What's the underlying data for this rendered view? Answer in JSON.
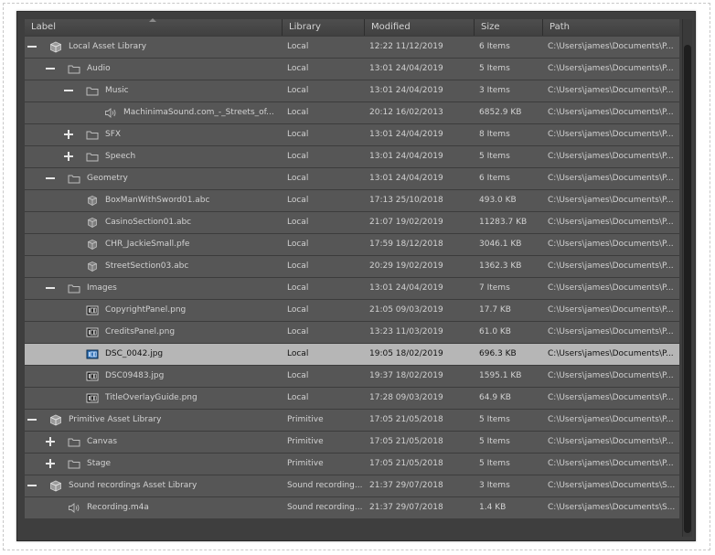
{
  "columns": {
    "label": "Label",
    "library": "Library",
    "modified": "Modified",
    "size": "Size",
    "path": "Path"
  },
  "rows": [
    {
      "depth": 0,
      "toggle": "minus",
      "icon": "asset-library-icon",
      "label": "Local Asset Library",
      "library": "Local",
      "modified": "12:22  11/12/2019",
      "size": "6 Items",
      "path": "C:\\Users\\james\\Documents\\P..."
    },
    {
      "depth": 1,
      "toggle": "minus",
      "icon": "folder-icon",
      "label": "Audio",
      "library": "Local",
      "modified": "13:01  24/04/2019",
      "size": "5 Items",
      "path": "C:\\Users\\james\\Documents\\P..."
    },
    {
      "depth": 2,
      "toggle": "minus",
      "icon": "folder-icon",
      "label": "Music",
      "library": "Local",
      "modified": "13:01  24/04/2019",
      "size": "3 Items",
      "path": "C:\\Users\\james\\Documents\\P..."
    },
    {
      "depth": 3,
      "toggle": "none",
      "icon": "sound-icon",
      "label": "MachinimaSound.com_-_Streets_of...",
      "library": "Local",
      "modified": "20:12  16/02/2013",
      "size": "6852.9 KB",
      "path": "C:\\Users\\james\\Documents\\P..."
    },
    {
      "depth": 2,
      "toggle": "plus",
      "icon": "folder-icon",
      "label": "SFX",
      "library": "Local",
      "modified": "13:01  24/04/2019",
      "size": "8 Items",
      "path": "C:\\Users\\james\\Documents\\P..."
    },
    {
      "depth": 2,
      "toggle": "plus",
      "icon": "folder-icon",
      "label": "Speech",
      "library": "Local",
      "modified": "13:01  24/04/2019",
      "size": "5 Items",
      "path": "C:\\Users\\james\\Documents\\P..."
    },
    {
      "depth": 1,
      "toggle": "minus",
      "icon": "folder-icon",
      "label": "Geometry",
      "library": "Local",
      "modified": "13:01  24/04/2019",
      "size": "6 Items",
      "path": "C:\\Users\\james\\Documents\\P..."
    },
    {
      "depth": 2,
      "toggle": "none",
      "icon": "geometry-icon",
      "label": "BoxManWithSword01.abc",
      "library": "Local",
      "modified": "17:13  25/10/2018",
      "size": "493.0 KB",
      "path": "C:\\Users\\james\\Documents\\P..."
    },
    {
      "depth": 2,
      "toggle": "none",
      "icon": "geometry-icon",
      "label": "CasinoSection01.abc",
      "library": "Local",
      "modified": "21:07  19/02/2019",
      "size": "11283.7 KB",
      "path": "C:\\Users\\james\\Documents\\P..."
    },
    {
      "depth": 2,
      "toggle": "none",
      "icon": "geometry-icon",
      "label": "CHR_JackieSmall.pfe",
      "library": "Local",
      "modified": "17:59  18/12/2018",
      "size": "3046.1 KB",
      "path": "C:\\Users\\james\\Documents\\P..."
    },
    {
      "depth": 2,
      "toggle": "none",
      "icon": "geometry-icon",
      "label": "StreetSection03.abc",
      "library": "Local",
      "modified": "20:29  19/02/2019",
      "size": "1362.3 KB",
      "path": "C:\\Users\\james\\Documents\\P..."
    },
    {
      "depth": 1,
      "toggle": "minus",
      "icon": "folder-icon",
      "label": "Images",
      "library": "Local",
      "modified": "13:01  24/04/2019",
      "size": "7 Items",
      "path": "C:\\Users\\james\\Documents\\P..."
    },
    {
      "depth": 2,
      "toggle": "none",
      "icon": "image-icon",
      "label": "CopyrightPanel.png",
      "library": "Local",
      "modified": "21:05  09/03/2019",
      "size": "17.7 KB",
      "path": "C:\\Users\\james\\Documents\\P..."
    },
    {
      "depth": 2,
      "toggle": "none",
      "icon": "image-icon",
      "label": "CreditsPanel.png",
      "library": "Local",
      "modified": "13:23  11/03/2019",
      "size": "61.0 KB",
      "path": "C:\\Users\\james\\Documents\\P..."
    },
    {
      "depth": 2,
      "toggle": "none",
      "icon": "image-icon",
      "label": "DSC_0042.jpg",
      "library": "Local",
      "modified": "19:05  18/02/2019",
      "size": "696.3 KB",
      "path": "C:\\Users\\james\\Documents\\P...",
      "selected": true
    },
    {
      "depth": 2,
      "toggle": "none",
      "icon": "image-icon",
      "label": "DSC09483.jpg",
      "library": "Local",
      "modified": "19:37  18/02/2019",
      "size": "1595.1 KB",
      "path": "C:\\Users\\james\\Documents\\P..."
    },
    {
      "depth": 2,
      "toggle": "none",
      "icon": "image-icon",
      "label": "TitleOverlayGuide.png",
      "library": "Local",
      "modified": "17:28  09/03/2019",
      "size": "64.9 KB",
      "path": "C:\\Users\\james\\Documents\\P..."
    },
    {
      "depth": 0,
      "toggle": "minus",
      "icon": "asset-library-icon",
      "label": "Primitive Asset Library",
      "library": "Primitive",
      "modified": "17:05  21/05/2018",
      "size": "5 Items",
      "path": "C:\\Users\\james\\Documents\\P..."
    },
    {
      "depth": 1,
      "toggle": "plus",
      "icon": "folder-icon",
      "label": "Canvas",
      "library": "Primitive",
      "modified": "17:05  21/05/2018",
      "size": "5 Items",
      "path": "C:\\Users\\james\\Documents\\P..."
    },
    {
      "depth": 1,
      "toggle": "plus",
      "icon": "folder-icon",
      "label": "Stage",
      "library": "Primitive",
      "modified": "17:05  21/05/2018",
      "size": "5 Items",
      "path": "C:\\Users\\james\\Documents\\P..."
    },
    {
      "depth": 0,
      "toggle": "minus",
      "icon": "asset-library-icon",
      "label": "Sound recordings Asset Library",
      "library": "Sound recording...",
      "modified": "21:37  29/07/2018",
      "size": "3 Items",
      "path": "C:\\Users\\james\\Documents\\S..."
    },
    {
      "depth": 1,
      "toggle": "none",
      "icon": "sound-icon",
      "label": "Recording.m4a",
      "library": "Sound recording...",
      "modified": "21:37  29/07/2018",
      "size": "1.4 KB",
      "path": "C:\\Users\\james\\Documents\\S..."
    }
  ],
  "colors": {
    "row_bg": "#565656",
    "selected_bg": "#b6b6b6",
    "panel_bg": "#3e3e3e",
    "text": "#d2d2d2"
  }
}
